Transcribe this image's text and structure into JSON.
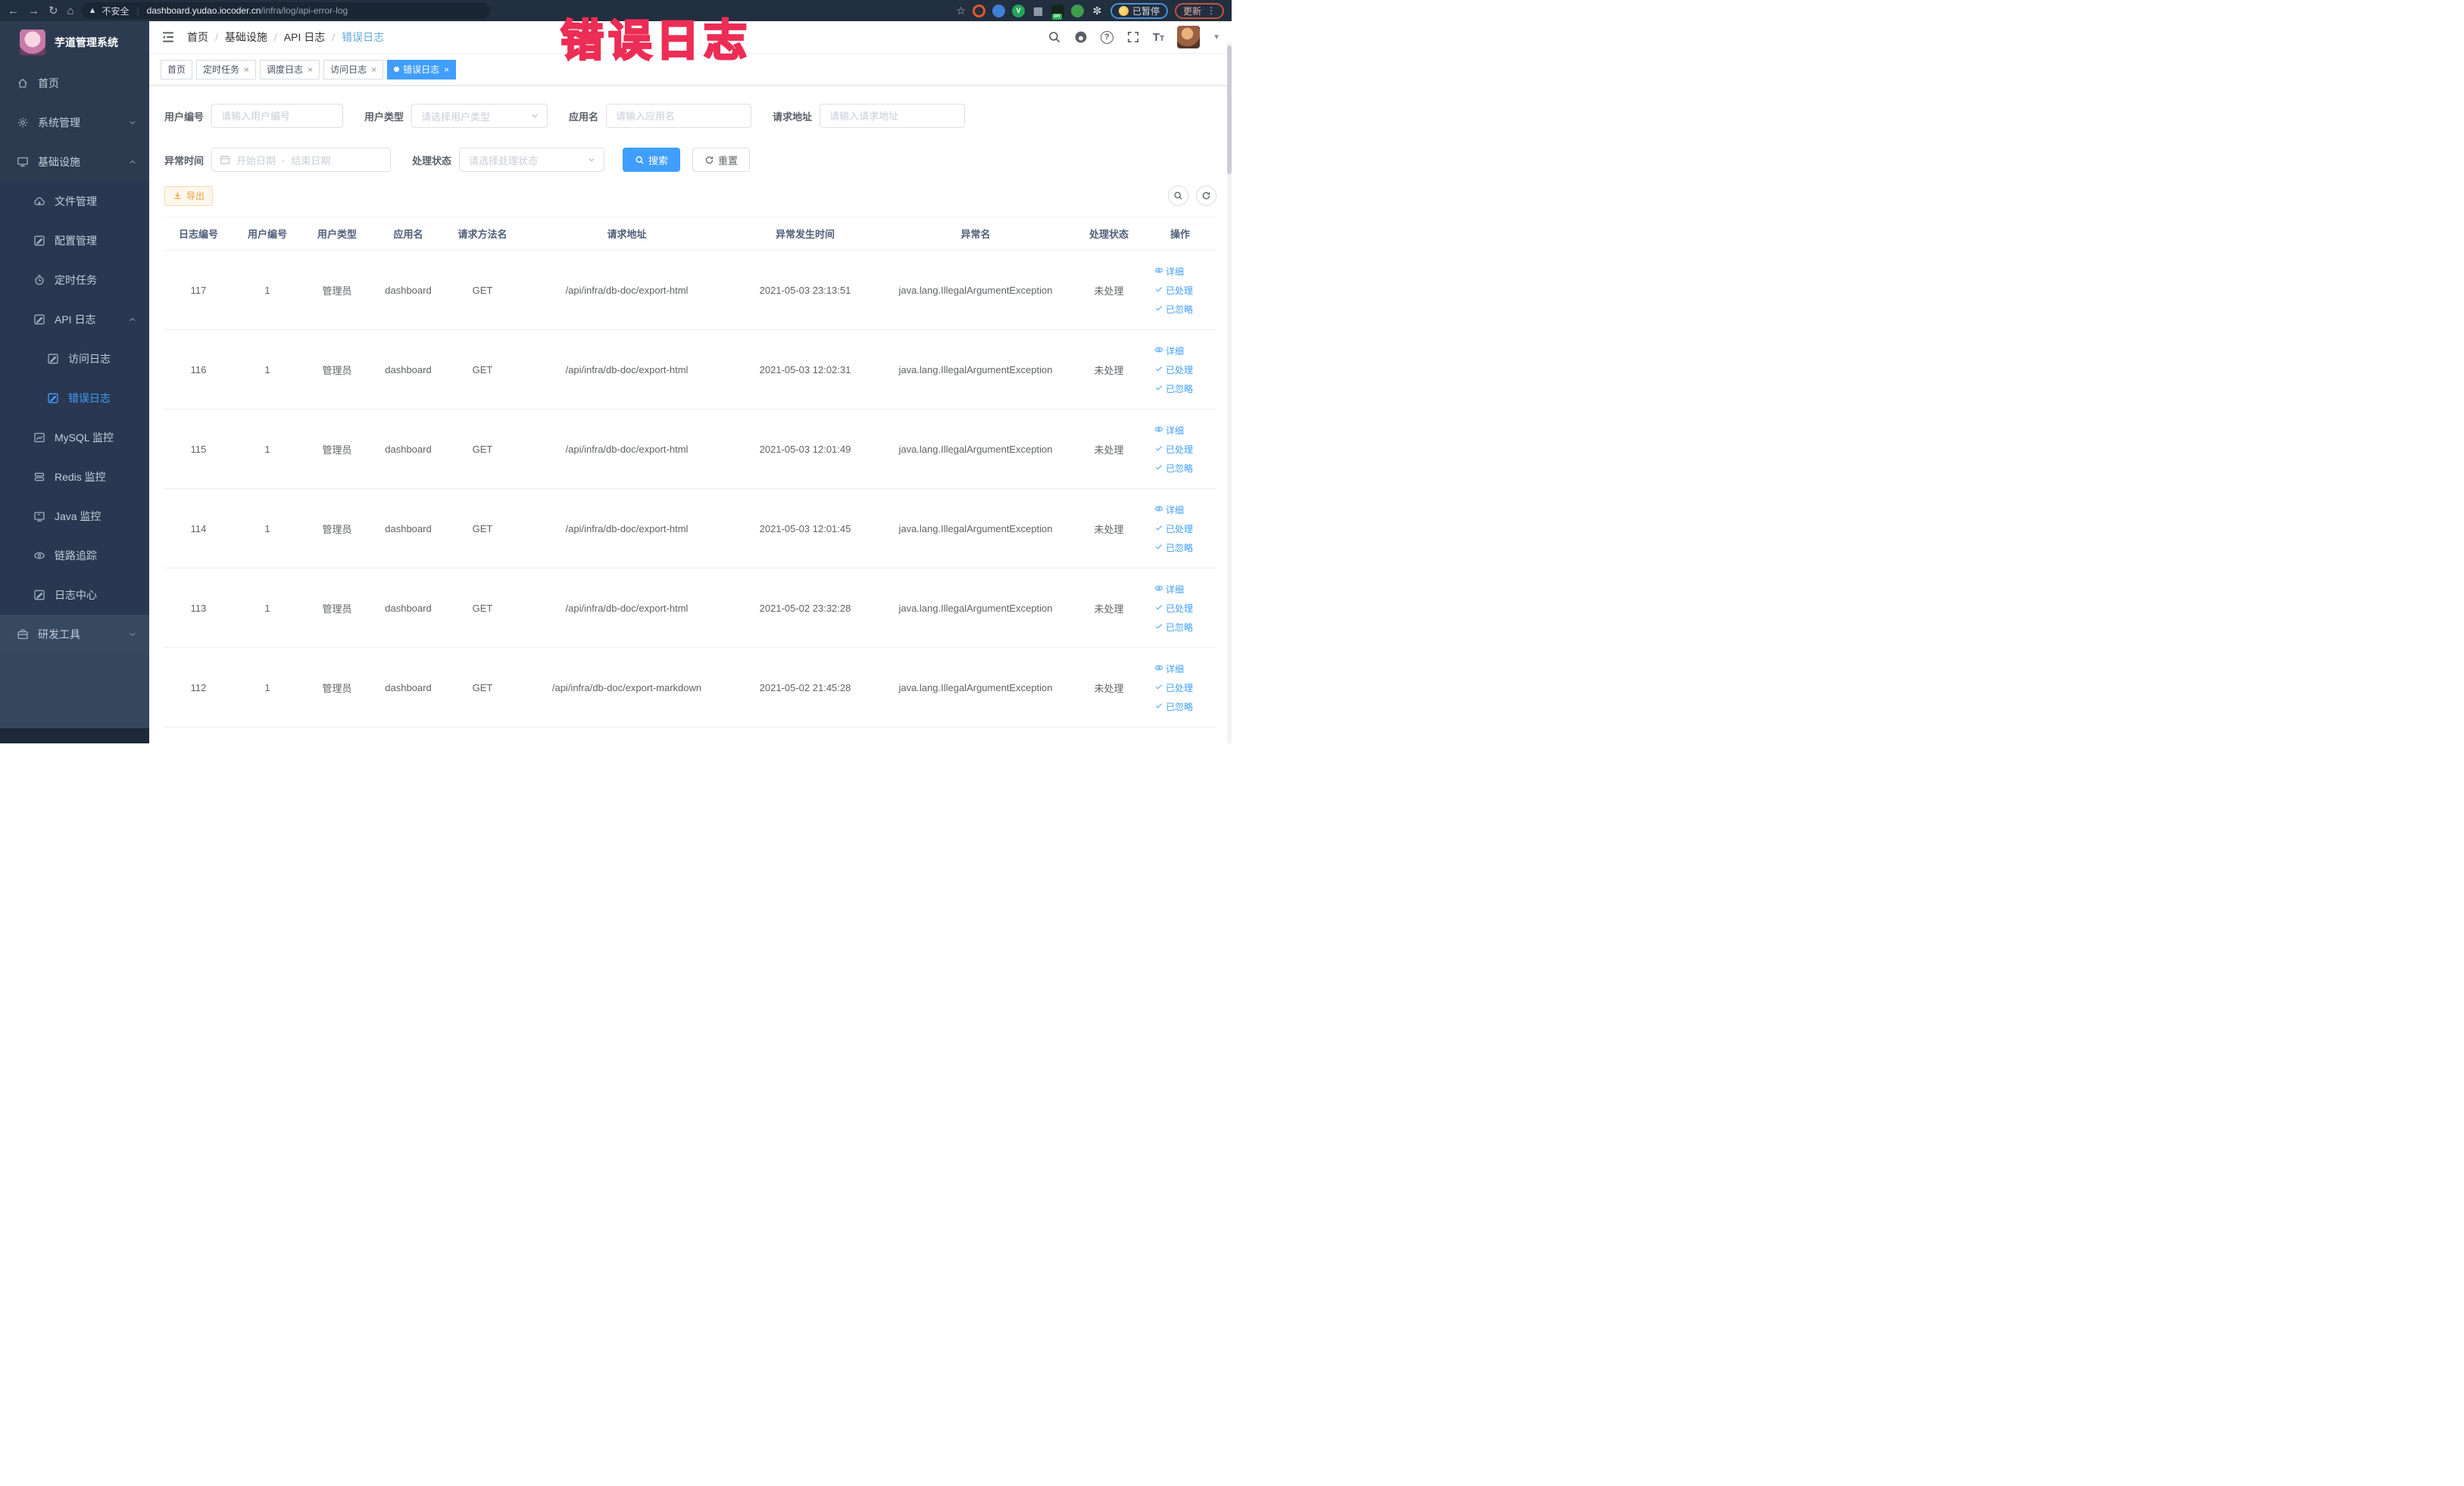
{
  "colors": {
    "accent": "#409eff",
    "warning_btn": "#e6a23c",
    "annotation": "#ec2d55",
    "sidebar_bg": "#2c3b50",
    "active_tab_bg": "#409eff"
  },
  "browser": {
    "security_label": "不安全",
    "url_host": "dashboard.yudao.iocoder.cn",
    "url_path": "/infra/log/api-error-log",
    "paused_chip": "已暂停",
    "update_chip": "更新",
    "extensions": [
      {
        "key": "orange-ring-extension",
        "color": "#e2572b",
        "shape": "ring"
      },
      {
        "key": "blue-pin-extension",
        "color": "#3f7fd6",
        "shape": "circle"
      },
      {
        "key": "green-v-extension",
        "color": "#23a55a",
        "shape": "circle",
        "glyph": "V"
      },
      {
        "key": "grid-extension",
        "color": "#cfd6dd",
        "shape": "glyphonly",
        "glyph": "▦"
      },
      {
        "key": "on-switch-extension",
        "color": "#15251b",
        "shape": "square",
        "badge": "on"
      },
      {
        "key": "leaf-extension",
        "color": "#3f9e4d",
        "shape": "circle"
      },
      {
        "key": "pinwheel-extension",
        "color": "#e9edf2",
        "shape": "glyphonly",
        "glyph": "✼"
      }
    ]
  },
  "sidebar": {
    "title": "芋道管理系统",
    "items": [
      {
        "key": "home",
        "label": "首页",
        "icon": "home",
        "level": 0
      },
      {
        "key": "system",
        "label": "系统管理",
        "icon": "gear",
        "level": 0,
        "chevron": "down"
      },
      {
        "key": "infra",
        "label": "基础设施",
        "icon": "monitor",
        "level": 0,
        "chevron": "up"
      },
      {
        "key": "file",
        "label": "文件管理",
        "icon": "cloud",
        "level": 1
      },
      {
        "key": "config",
        "label": "配置管理",
        "icon": "edit",
        "level": 1
      },
      {
        "key": "job",
        "label": "定时任务",
        "icon": "timer",
        "level": 1
      },
      {
        "key": "api-log",
        "label": "API 日志",
        "icon": "doc",
        "level": 1,
        "chevron": "up"
      },
      {
        "key": "access-log",
        "label": "访问日志",
        "icon": "doc",
        "level": 2
      },
      {
        "key": "error-log",
        "label": "错误日志",
        "icon": "doc",
        "level": 2,
        "active": true
      },
      {
        "key": "mysql",
        "label": "MySQL 监控",
        "icon": "chart",
        "level": 1
      },
      {
        "key": "redis",
        "label": "Redis 监控",
        "icon": "stack",
        "level": 1
      },
      {
        "key": "java",
        "label": "Java 监控",
        "icon": "screen",
        "level": 1
      },
      {
        "key": "trace",
        "label": "链路追踪",
        "icon": "eye",
        "level": 1
      },
      {
        "key": "log-center",
        "label": "日志中心",
        "icon": "doc",
        "level": 1
      },
      {
        "key": "dev-tools",
        "label": "研发工具",
        "icon": "case",
        "level": 0,
        "chevron": "down",
        "light": true
      }
    ]
  },
  "header": {
    "breadcrumbs": [
      "首页",
      "基础设施",
      "API 日志",
      "错误日志"
    ]
  },
  "tabs": [
    {
      "label": "首页",
      "closable": false,
      "active": false
    },
    {
      "label": "定时任务",
      "closable": true,
      "active": false
    },
    {
      "label": "调度日志",
      "closable": true,
      "active": false
    },
    {
      "label": "访问日志",
      "closable": true,
      "active": false
    },
    {
      "label": "错误日志",
      "closable": true,
      "active": true
    }
  ],
  "annotation": {
    "text": "错误日志"
  },
  "filters": {
    "user_id": {
      "label": "用户编号",
      "placeholder": "请输入用户编号"
    },
    "user_type": {
      "label": "用户类型",
      "placeholder": "请选择用户类型"
    },
    "app_name": {
      "label": "应用名",
      "placeholder": "请输入应用名"
    },
    "request_url": {
      "label": "请求地址",
      "placeholder": "请输入请求地址"
    },
    "exception_time": {
      "label": "异常时间",
      "start_placeholder": "开始日期",
      "separator": "-",
      "end_placeholder": "结束日期"
    },
    "process_status": {
      "label": "处理状态",
      "placeholder": "请选择处理状态"
    },
    "search_btn": "搜索",
    "reset_btn": "重置",
    "export_btn": "导出"
  },
  "table": {
    "headers": [
      "日志编号",
      "用户编号",
      "用户类型",
      "应用名",
      "请求方法名",
      "请求地址",
      "异常发生时间",
      "异常名",
      "处理状态",
      "操作"
    ],
    "action_labels": [
      "详细",
      "已处理",
      "已忽略"
    ],
    "rows": [
      {
        "id": "117",
        "user_id": "1",
        "user_type": "管理员",
        "app": "dashboard",
        "method": "GET",
        "url": "/api/infra/db-doc/export-html",
        "time": "2021-05-03 23:13:51",
        "exception": "java.lang.IllegalArgumentException",
        "status": "未处理"
      },
      {
        "id": "116",
        "user_id": "1",
        "user_type": "管理员",
        "app": "dashboard",
        "method": "GET",
        "url": "/api/infra/db-doc/export-html",
        "time": "2021-05-03 12:02:31",
        "exception": "java.lang.IllegalArgumentException",
        "status": "未处理"
      },
      {
        "id": "115",
        "user_id": "1",
        "user_type": "管理员",
        "app": "dashboard",
        "method": "GET",
        "url": "/api/infra/db-doc/export-html",
        "time": "2021-05-03 12:01:49",
        "exception": "java.lang.IllegalArgumentException",
        "status": "未处理"
      },
      {
        "id": "114",
        "user_id": "1",
        "user_type": "管理员",
        "app": "dashboard",
        "method": "GET",
        "url": "/api/infra/db-doc/export-html",
        "time": "2021-05-03 12:01:45",
        "exception": "java.lang.IllegalArgumentException",
        "status": "未处理"
      },
      {
        "id": "113",
        "user_id": "1",
        "user_type": "管理员",
        "app": "dashboard",
        "method": "GET",
        "url": "/api/infra/db-doc/export-html",
        "time": "2021-05-02 23:32:28",
        "exception": "java.lang.IllegalArgumentException",
        "status": "未处理"
      },
      {
        "id": "112",
        "user_id": "1",
        "user_type": "管理员",
        "app": "dashboard",
        "method": "GET",
        "url": "/api/infra/db-doc/export-markdown",
        "time": "2021-05-02 21:45:28",
        "exception": "java.lang.IllegalArgumentException",
        "status": "未处理"
      }
    ]
  }
}
